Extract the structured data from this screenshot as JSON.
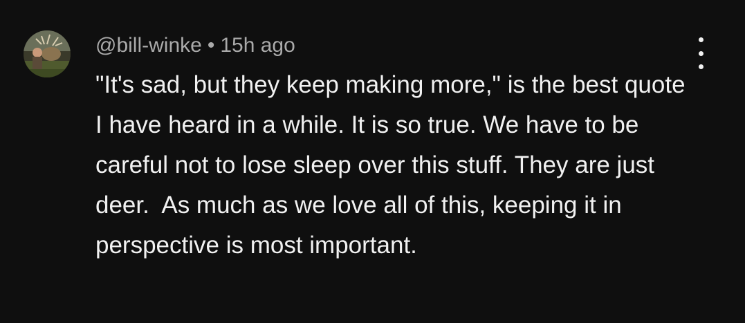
{
  "comment": {
    "author_handle": "@bill-winke",
    "separator": "•",
    "timestamp": "15h ago",
    "text": "\"It's sad, but they keep making more,\" is the best quote I have heard in a while. It is so true. We have to be careful not to lose sleep over this stuff. They are just deer.  As much as we love all of this, keeping it in perspective is most important.",
    "avatar_icon": "user-avatar-photo-icon",
    "menu_icon": "more-vert-icon"
  },
  "colors": {
    "background": "#0f0f0f",
    "text_primary": "#f1f1f1",
    "text_secondary": "#aaaaaa"
  }
}
